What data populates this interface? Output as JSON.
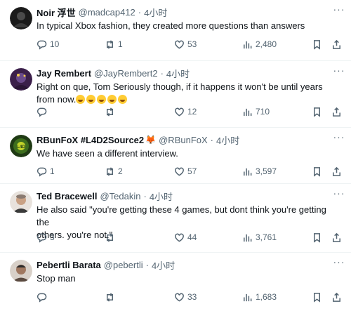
{
  "tweets": [
    {
      "name": "Noir 浮世",
      "handle": "@madcap412",
      "time": "4小时",
      "text": "In typical Xbox fashion, they created more questions than answers",
      "replies": "10",
      "retweets": "1",
      "likes": "53",
      "views": "2,480",
      "avatar_color": "#1a1a1a"
    },
    {
      "name": "Jay Rembert",
      "handle": "@JayRembert2",
      "time": "4小时",
      "text_line1": "Right on que, Tom  Seriously though, if it happens it won't be until years",
      "text_line2": "from now.",
      "emoji_count": "5",
      "replies": "",
      "retweets": "",
      "likes": "12",
      "views": "710",
      "avatar_color": "#3b1f4a"
    },
    {
      "name": "RBunFoX #L4D2Source2",
      "fox_emoji": "🦊",
      "handle": "@RBunFoX",
      "time": "4小时",
      "text": "We have seen a different interview.",
      "replies": "1",
      "retweets": "2",
      "likes": "57",
      "views": "3,597",
      "avatar_color": "#1f3a14"
    },
    {
      "name": "Ted Bracewell",
      "handle": "@Tedakin",
      "time": "4小时",
      "text_line1": "He also said \"you're getting these 4 games, but dont think you're getting the",
      "text_line2": "others. you're not.\"",
      "replies": "3",
      "retweets": "",
      "likes": "44",
      "views": "3,761",
      "avatar_color": "#c9a184"
    },
    {
      "name": "Pebertli Barata",
      "handle": "@pebertli",
      "time": "4小时",
      "text": "Stop man",
      "replies": "",
      "retweets": "",
      "likes": "33",
      "views": "1,683",
      "avatar_color": "#a07860"
    }
  ],
  "separator": "·",
  "more_label": "···"
}
